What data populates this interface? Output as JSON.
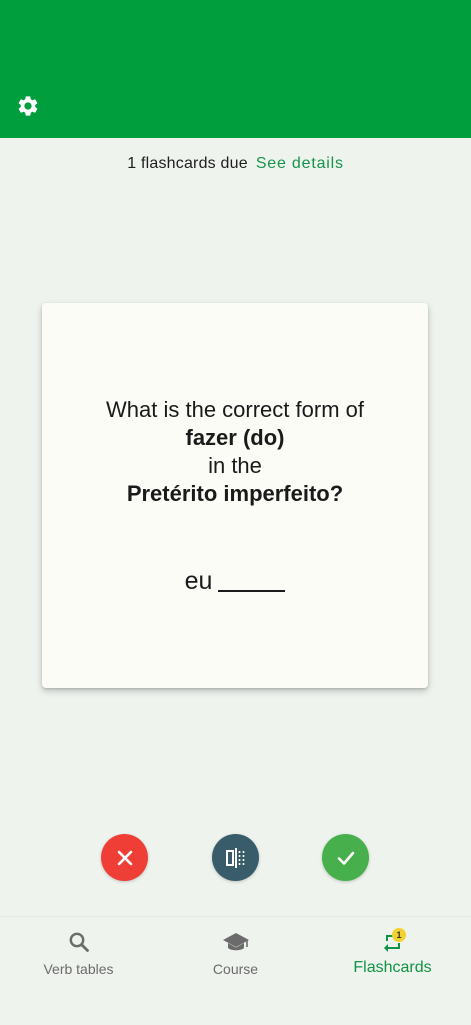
{
  "colors": {
    "header": "#009e3d",
    "background": "#eff3ee",
    "card": "#fbfcf6",
    "accent_text": "#17944a",
    "wrong_button": "#ef3e36",
    "flip_button": "#385c6a",
    "right_button": "#47b04d",
    "badge": "#f2d22e"
  },
  "header": {
    "settings_icon": "gear-icon"
  },
  "due": {
    "text": "1 flashcards due",
    "link": "See details"
  },
  "card": {
    "line1": "What is the correct form of",
    "verb": "fazer (do)",
    "line3": "in the",
    "tense": "Pretérito imperfeito?",
    "pronoun": "eu"
  },
  "actions": {
    "wrong_icon": "close-icon",
    "flip_icon": "flip-icon",
    "right_icon": "check-icon"
  },
  "nav": {
    "items": [
      {
        "label": "Verb tables",
        "icon": "search-icon"
      },
      {
        "label": "Course",
        "icon": "graduation-cap-icon"
      },
      {
        "label": "Flashcards",
        "icon": "repeat-icon",
        "badge": "1"
      }
    ]
  }
}
